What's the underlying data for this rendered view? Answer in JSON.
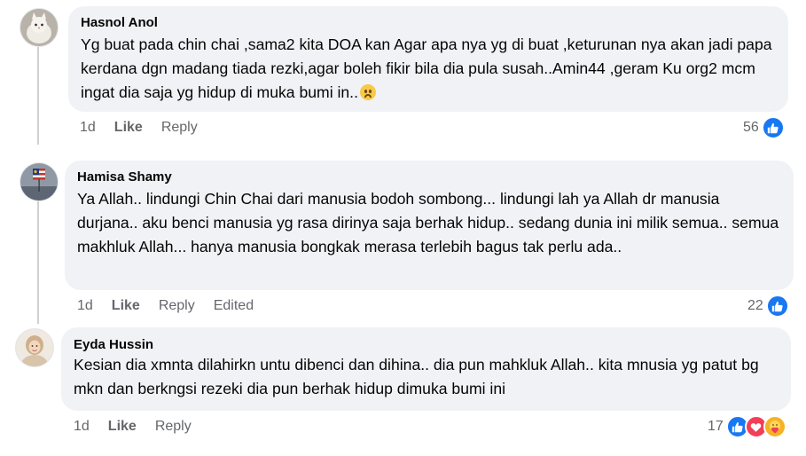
{
  "comments": [
    {
      "author": "Hasnol Anol",
      "avatar_icon": "cat-avatar-icon",
      "text": "Yg buat pada chin chai ,sama2 kita DOA kan Agar apa nya yg di buat ,keturunan nya akan jadi papa kerdana dgn madang tiada rezki,agar boleh fikir bila dia pula susah..Amin44 ,geram Ku org2 mcm ingat dia saja yg hidup di muka bumi in..",
      "emoji": "crying-face-icon",
      "time": "1d",
      "like_label": "Like",
      "reply_label": "Reply",
      "reaction_count": "56",
      "reactions": [
        "like-icon"
      ]
    },
    {
      "author": "Hamisa Shamy",
      "avatar_icon": "flag-avatar-icon",
      "text": "Ya Allah.. lindungi Chin Chai dari manusia bodoh sombong... lindungi lah ya Allah dr manusia durjana.. aku benci manusia yg rasa dirinya saja berhak hidup.. sedang dunia ini milik semua.. semua makhluk Allah... hanya manusia bongkak merasa terlebih bagus tak perlu ada..",
      "time": "1d",
      "like_label": "Like",
      "reply_label": "Reply",
      "edited_label": "Edited",
      "reaction_count": "22",
      "reactions": [
        "like-icon"
      ]
    },
    {
      "author": "Eyda Hussin",
      "avatar_icon": "person-avatar-icon",
      "text": "Kesian dia xmnta dilahirkn untu dibenci dan dihina.. dia pun mahkluk Allah.. kita mnusia yg patut bg mkn dan berkngsi rezeki dia pun berhak hidup dimuka bumi ini",
      "time": "1d",
      "like_label": "Like",
      "reply_label": "Reply",
      "reaction_count": "17",
      "reactions": [
        "like-icon",
        "love-icon",
        "care-icon"
      ]
    }
  ],
  "colors": {
    "bubble": "#f0f2f5",
    "meta_text": "#65676b",
    "like_blue": "#1877f2",
    "love_red": "#f33e58",
    "care_yellow": "#f7b125"
  }
}
